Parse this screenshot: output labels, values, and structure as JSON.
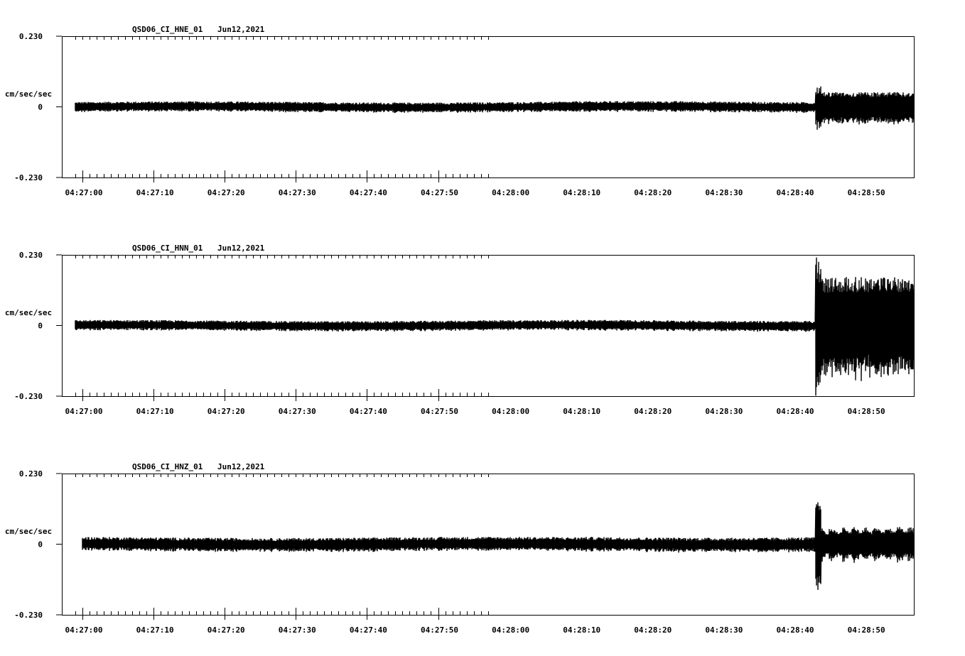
{
  "chart_data": [
    {
      "type": "line",
      "title": "QSD06_CI_HNE_01",
      "date": "Jun12,2021",
      "ylabel": "cm/sec/sec",
      "ylim": [
        -0.23,
        0.23
      ],
      "ytick_labels": [
        "0.230",
        "0",
        "-0.230"
      ],
      "xtick_labels": [
        "04:27:00",
        "04:27:10",
        "04:27:20",
        "04:27:30",
        "04:27:40",
        "04:27:50",
        "04:28:00",
        "04:28:10",
        "04:28:20",
        "04:28:30",
        "04:28:40",
        "04:28:50"
      ],
      "x_seconds_range": [
        -1.5,
        57.5
      ],
      "trace": {
        "start_s": -1.0,
        "event_s": 101.0,
        "pre_noise": 0.016,
        "post_amp": 0.045,
        "event_peak": 0.07
      }
    },
    {
      "type": "line",
      "title": "QSD06_CI_HNN_01",
      "date": "Jun12,2021",
      "ylabel": "cm/sec/sec",
      "ylim": [
        -0.23,
        0.23
      ],
      "ytick_labels": [
        "0.230",
        "0",
        "-0.230"
      ],
      "xtick_labels": [
        "04:27:00",
        "04:27:10",
        "04:27:20",
        "04:27:30",
        "04:27:40",
        "04:27:50",
        "04:28:00",
        "04:28:10",
        "04:28:20",
        "04:28:30",
        "04:28:40",
        "04:28:50"
      ],
      "x_seconds_range": [
        -1.5,
        57.5
      ],
      "trace": {
        "start_s": -1.0,
        "event_s": 101.0,
        "pre_noise": 0.016,
        "post_amp": 0.145,
        "event_peak": 0.23
      }
    },
    {
      "type": "line",
      "title": "QSD06_CI_HNZ_01",
      "date": "Jun12,2021",
      "ylabel": "cm/sec/sec",
      "ylim": [
        -0.23,
        0.23
      ],
      "ytick_labels": [
        "0.230",
        "0",
        "-0.230"
      ],
      "xtick_labels": [
        "04:27:00",
        "04:27:10",
        "04:27:20",
        "04:27:30",
        "04:27:40",
        "04:27:50",
        "04:28:00",
        "04:28:10",
        "04:28:20",
        "04:28:30",
        "04:28:40",
        "04:28:50"
      ],
      "x_seconds_range": [
        -1.5,
        57.5
      ],
      "trace": {
        "start_s": 0.0,
        "event_s": 101.0,
        "pre_noise": 0.022,
        "post_amp": 0.05,
        "event_peak": 0.18
      }
    }
  ]
}
